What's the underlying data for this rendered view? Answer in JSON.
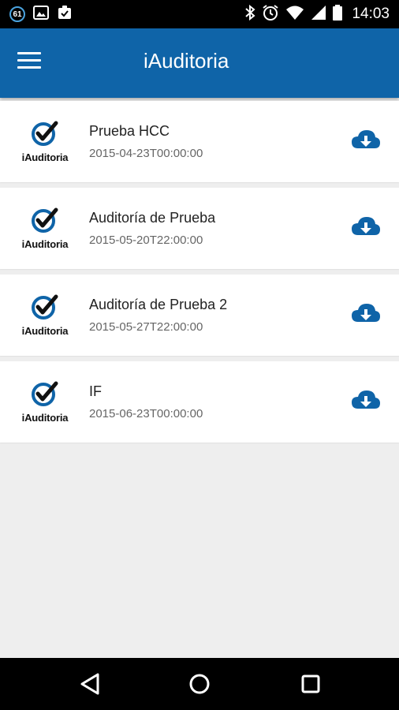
{
  "status_bar": {
    "notification_count": "61",
    "time": "14:03"
  },
  "app_bar": {
    "title": "iAuditoria"
  },
  "logo_text": "iAuditoria",
  "audits": [
    {
      "title": "Prueba HCC",
      "date": "2015-04-23T00:00:00"
    },
    {
      "title": "Auditoría de Prueba",
      "date": "2015-05-20T22:00:00"
    },
    {
      "title": "Auditoría de Prueba 2",
      "date": "2015-05-27T22:00:00"
    },
    {
      "title": "IF",
      "date": "2015-06-23T00:00:00"
    }
  ],
  "icons": {
    "menu": "hamburger-menu-icon",
    "download": "cloud-download-icon",
    "nav_back": "back-triangle-icon",
    "nav_home": "home-circle-icon",
    "nav_recents": "recents-square-icon"
  },
  "colors": {
    "app_bar": "#0f64a8",
    "accent": "#0f64a8",
    "background": "#eeeeee"
  }
}
